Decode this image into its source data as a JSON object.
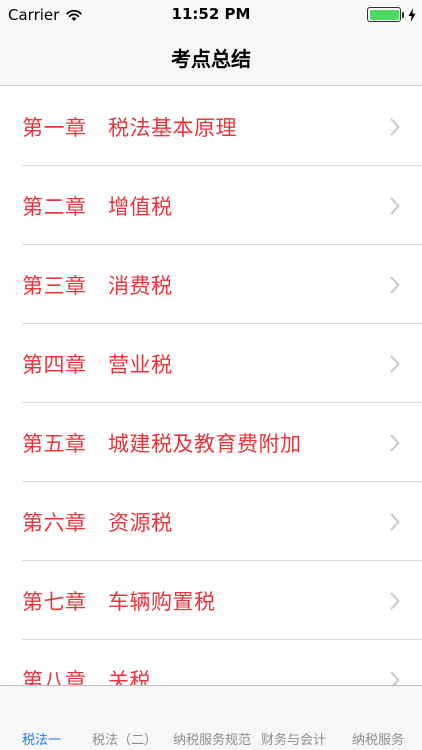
{
  "status_bar": {
    "carrier": "Carrier",
    "time": "11:52 PM",
    "battery_level": 1.0,
    "battery_color": "#4cd964",
    "icons": [
      "wifi-icon",
      "battery-icon",
      "charging-bolt-icon"
    ]
  },
  "nav": {
    "title": "考点总结"
  },
  "chapters": [
    {
      "label": "第一章　税法基本原理"
    },
    {
      "label": "第二章　增值税"
    },
    {
      "label": "第三章　消费税"
    },
    {
      "label": "第四章　营业税"
    },
    {
      "label": "第五章　城建税及教育费附加"
    },
    {
      "label": "第六章　资源税"
    },
    {
      "label": "第七章　车辆购置税"
    },
    {
      "label": "第八章　关税"
    }
  ],
  "tabs": [
    {
      "label": "税法一",
      "active": true
    },
    {
      "label": "税法（二）",
      "active": false
    },
    {
      "label": "纳税服务规范",
      "active": false
    },
    {
      "label": "财务与会计",
      "active": false
    },
    {
      "label": "纳税服务",
      "active": false
    }
  ],
  "colors": {
    "chapter_text": "#e8353a",
    "tab_active": "#1a7cf5",
    "tab_inactive": "#8e8e8e"
  }
}
